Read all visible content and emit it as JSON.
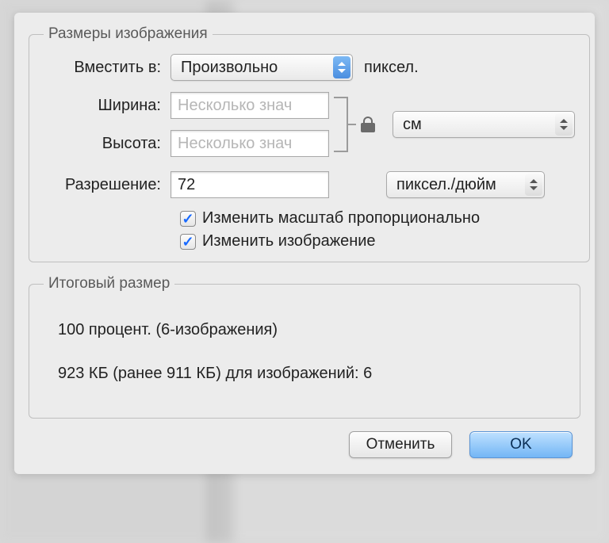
{
  "group1": {
    "legend": "Размеры изображения",
    "fit": {
      "label": "Вместить в:",
      "value": "Произвольно",
      "suffix": "пиксел."
    },
    "width": {
      "label": "Ширина:",
      "placeholder": "Несколько знач"
    },
    "height": {
      "label": "Высота:",
      "placeholder": "Несколько знач"
    },
    "unit_wh": "см",
    "resolution": {
      "label": "Разрешение:",
      "value": "72",
      "unit": "пиксел./дюйм"
    },
    "scale_proportional": "Изменить масштаб пропорционально",
    "resize_image": "Изменить изображение"
  },
  "group2": {
    "legend": "Итоговый размер",
    "line1": "100 процент. (6-изображения)",
    "line2": "923 КБ (ранее 911 КБ) для изображений: 6"
  },
  "buttons": {
    "cancel": "Отменить",
    "ok": "OK"
  }
}
